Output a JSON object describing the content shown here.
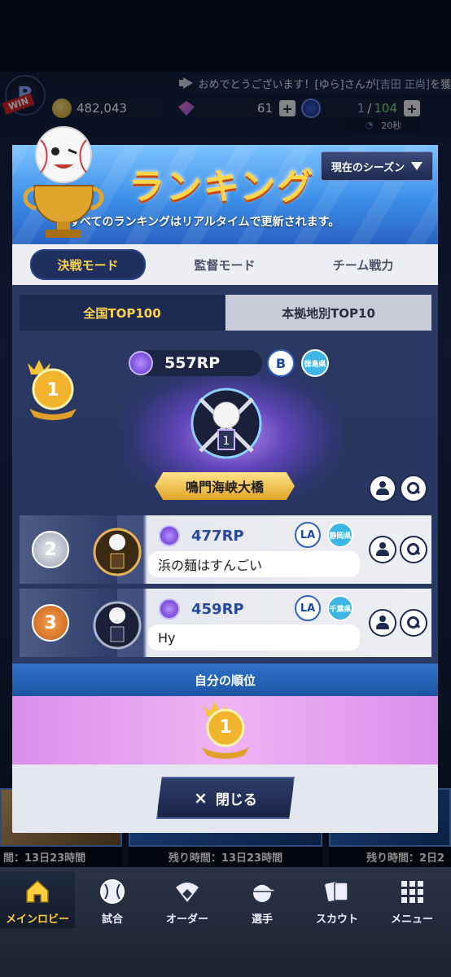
{
  "ticker": {
    "text_a": "おめでとうございます！[ゆら]さんが",
    "text_b": "[吉田 正尚]",
    "text_c": "を獲"
  },
  "badge": {
    "win": "WIN",
    "logo_letter": "B"
  },
  "resources": {
    "coins": "482,043",
    "gems": "61",
    "stamina_current": "1",
    "stamina_sep": "/",
    "stamina_max": "104",
    "timer": "20秒",
    "plus": "+"
  },
  "ranking": {
    "title": "ランキング",
    "subtitle": "すべてのランキングはリアルタイムで更新されます。",
    "season_button": "現在のシーズン",
    "tabs": [
      "決戦モード",
      "監督モード",
      "チーム戦力"
    ],
    "subtabs": [
      "全国TOP100",
      "本拠地別TOP10"
    ],
    "first": {
      "rank": "1",
      "rp": "557RP",
      "team": "B",
      "prefecture": "徳島県",
      "name": "鳴門海峡大橋"
    },
    "rows": [
      {
        "rank": "2",
        "rp": "477RP",
        "team": "LA",
        "prefecture": "静岡県",
        "comment": "浜の麺はすんごい"
      },
      {
        "rank": "3",
        "rp": "459RP",
        "team": "LA",
        "prefecture": "千葉県",
        "comment": "Hy"
      }
    ],
    "my_rank_title": "自分の順位",
    "my_rank": "1",
    "close_label": "閉じる",
    "close_icon": "×"
  },
  "background": {
    "remaining": [
      {
        "text": "間：13日23時間"
      },
      {
        "text": "残り時間：13日23時間"
      },
      {
        "text": "残り時間：2日2"
      }
    ]
  },
  "tabbar": {
    "items": [
      {
        "label": "メインロビー",
        "icon": "home-icon"
      },
      {
        "label": "試合",
        "icon": "baseball-icon"
      },
      {
        "label": "オーダー",
        "icon": "diamond-field-icon"
      },
      {
        "label": "選手",
        "icon": "player-cap-icon"
      },
      {
        "label": "スカウト",
        "icon": "cards-icon"
      },
      {
        "label": "メニュー",
        "icon": "grid-menu-icon"
      }
    ]
  },
  "colors": {
    "gold": "#ffd24d",
    "navy": "#1f2f5e",
    "rp_blue": "#2848a0"
  }
}
